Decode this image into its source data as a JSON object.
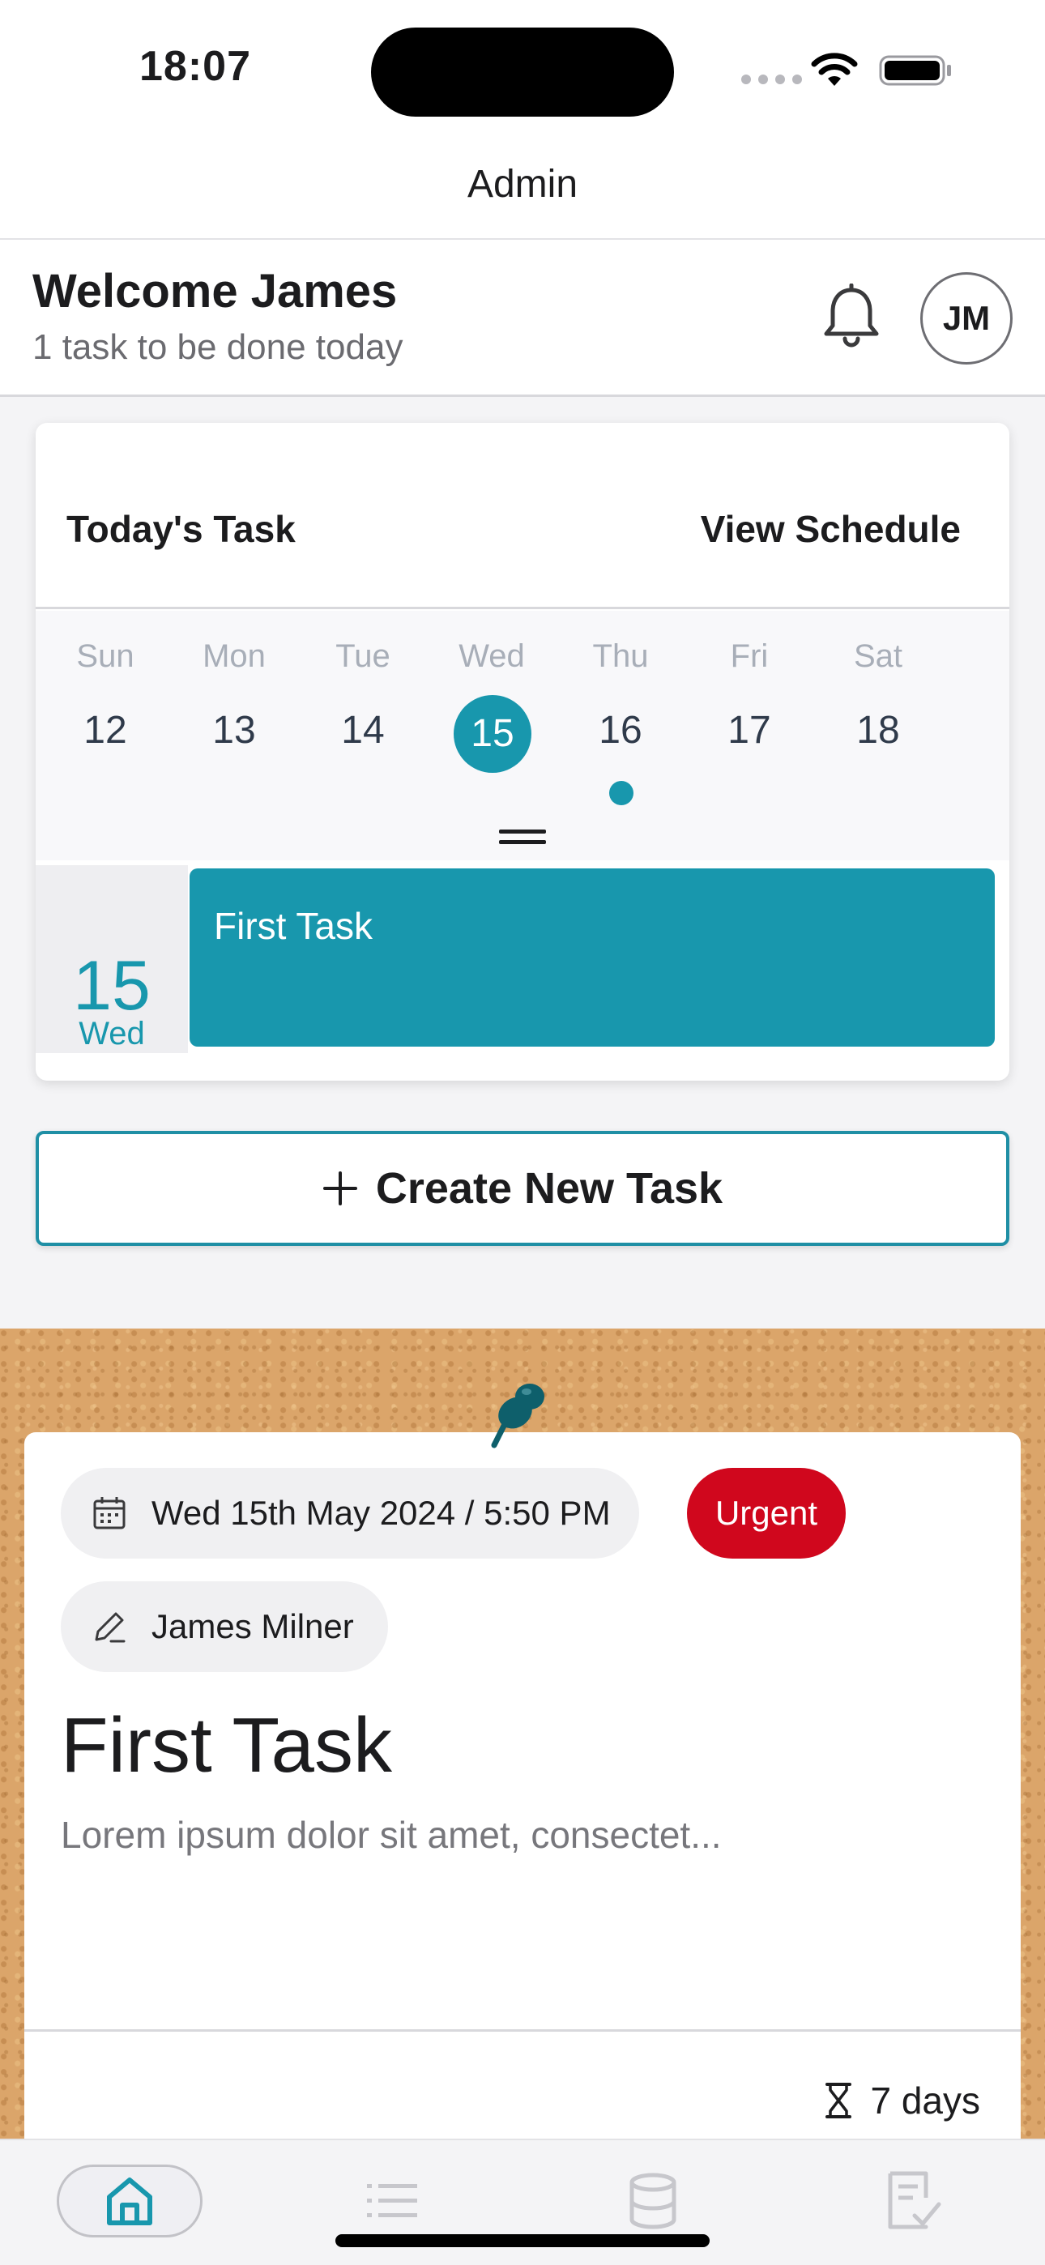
{
  "status_bar": {
    "time": "18:07"
  },
  "nav": {
    "title": "Admin"
  },
  "welcome": {
    "name": "Welcome James",
    "subtitle": "1 task to be done today",
    "avatar_initials": "JM"
  },
  "today_card": {
    "title": "Today's Task",
    "view_schedule": "View Schedule",
    "week": [
      {
        "name": "Sun",
        "num": "12"
      },
      {
        "name": "Mon",
        "num": "13"
      },
      {
        "name": "Tue",
        "num": "14"
      },
      {
        "name": "Wed",
        "num": "15",
        "selected": true
      },
      {
        "name": "Thu",
        "num": "16",
        "has_task": true
      },
      {
        "name": "Fri",
        "num": "17"
      },
      {
        "name": "Sat",
        "num": "18"
      }
    ],
    "agenda": {
      "day_num": "15",
      "weekday": "Wed",
      "event_title": "First Task"
    }
  },
  "create_button": {
    "label": "Create New Task"
  },
  "task_note": {
    "datetime": "Wed 15th May 2024 / 5:50 PM",
    "priority": "Urgent",
    "author": "James Milner",
    "title": "First Task",
    "description": "Lorem ipsum dolor sit amet, consectet...",
    "duration": "7 days"
  },
  "tabbar": {
    "items": [
      "home-icon",
      "list-icon",
      "database-icon",
      "checklist-icon"
    ]
  },
  "colors": {
    "accent": "#1897ad",
    "urgent": "#d0071d",
    "cork": "#dba56a"
  }
}
